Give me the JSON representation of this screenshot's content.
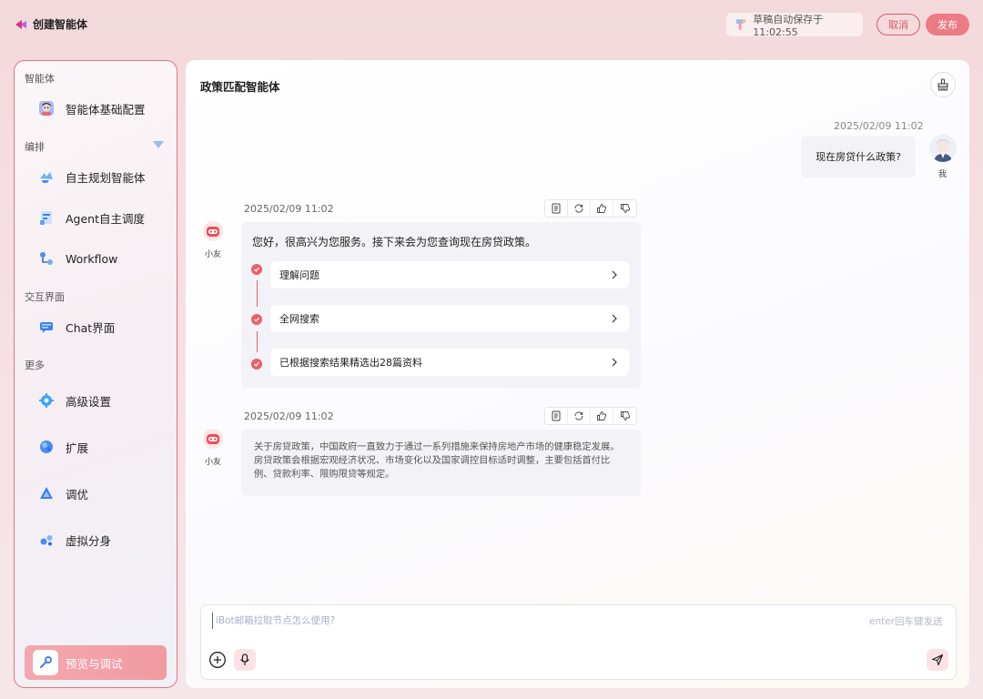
{
  "header": {
    "title": "创建智能体",
    "autosave_text": "草稿自动保存于11:02:55",
    "cancel_label": "取消",
    "publish_label": "发布"
  },
  "sidebar": {
    "sections": [
      {
        "title": "智能体"
      },
      {
        "title": "编排"
      },
      {
        "title": "交互界面"
      },
      {
        "title": "更多"
      }
    ],
    "items": [
      {
        "label": "智能体基础配置",
        "icon": "avatar-icon"
      },
      {
        "label": "自主规划智能体",
        "icon": "planning-icon"
      },
      {
        "label": "Agent自主调度",
        "icon": "agent-schedule-icon"
      },
      {
        "label": "Workflow",
        "icon": "workflow-icon"
      },
      {
        "label": "Chat界面",
        "icon": "chat-icon"
      },
      {
        "label": "高级设置",
        "icon": "gear-icon"
      },
      {
        "label": "扩展",
        "icon": "extension-icon"
      },
      {
        "label": "调优",
        "icon": "tuning-icon"
      },
      {
        "label": "虚拟分身",
        "icon": "virtual-avatar-icon"
      }
    ],
    "preview_label": "预览与调试"
  },
  "main": {
    "title": "政策匹配智能体",
    "user_message": {
      "time": "2025/02/09 11:02",
      "text": "现在房贷什么政策?",
      "name": "我"
    },
    "bot_messages": [
      {
        "time": "2025/02/09 11:02",
        "name": "小友",
        "greeting": "您好，很高兴为您服务。接下来会为您查询现在房贷政策。",
        "steps": [
          "理解问题",
          "全网搜索",
          "已根据搜索结果精选出28篇资料"
        ]
      },
      {
        "time": "2025/02/09 11:02",
        "name": "小友",
        "text": "关于房贷政策，中国政府一直致力于通过一系列措施来保持房地产市场的健康稳定发展。房贷政策会根据宏观经济状况、市场变化以及国家调控目标适时调整，主要包括首付比例、贷款利率、限购限贷等规定。"
      }
    ],
    "input": {
      "placeholder": "iBot邮箱拉取节点怎么使用?",
      "hint": "enter回车键发送"
    }
  },
  "colors": {
    "accent": "#ec5f6a",
    "publish_bg": "#ec7b83",
    "sidebar_border": "#e9737c"
  }
}
